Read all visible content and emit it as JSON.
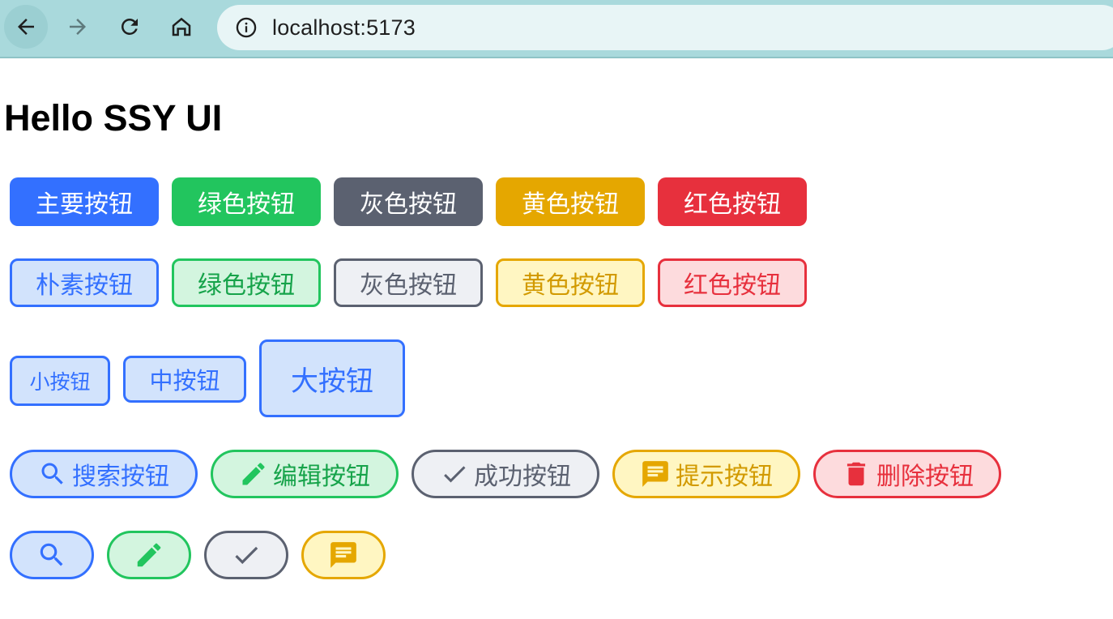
{
  "browser": {
    "url": "localhost:5173",
    "icons": [
      "back-arrow-icon",
      "forward-arrow-icon",
      "reload-icon",
      "home-icon",
      "info-icon"
    ]
  },
  "page": {
    "title": "Hello SSY UI"
  },
  "solid_row": [
    {
      "label": "主要按钮",
      "color": "#3370ff"
    },
    {
      "label": "绿色按钮",
      "color": "#22c55e"
    },
    {
      "label": "灰色按钮",
      "color": "#5b6170"
    },
    {
      "label": "黄色按钮",
      "color": "#e5a700"
    },
    {
      "label": "红色按钮",
      "color": "#e7303d"
    }
  ],
  "plain_row": [
    {
      "label": "朴素按钮"
    },
    {
      "label": "绿色按钮"
    },
    {
      "label": "灰色按钮"
    },
    {
      "label": "黄色按钮"
    },
    {
      "label": "红色按钮"
    }
  ],
  "size_row": [
    {
      "label": "小按钮"
    },
    {
      "label": "中按钮"
    },
    {
      "label": "大按钮"
    }
  ],
  "icon_row": [
    {
      "label": "搜索按钮",
      "icon": "search-icon"
    },
    {
      "label": "编辑按钮",
      "icon": "edit-icon"
    },
    {
      "label": "成功按钮",
      "icon": "check-icon"
    },
    {
      "label": "提示按钮",
      "icon": "message-icon"
    },
    {
      "label": "删除按钮",
      "icon": "delete-icon"
    }
  ],
  "icon_only_row": [
    {
      "icon": "search-icon"
    },
    {
      "icon": "edit-icon"
    },
    {
      "icon": "check-icon"
    },
    {
      "icon": "message-icon"
    }
  ]
}
